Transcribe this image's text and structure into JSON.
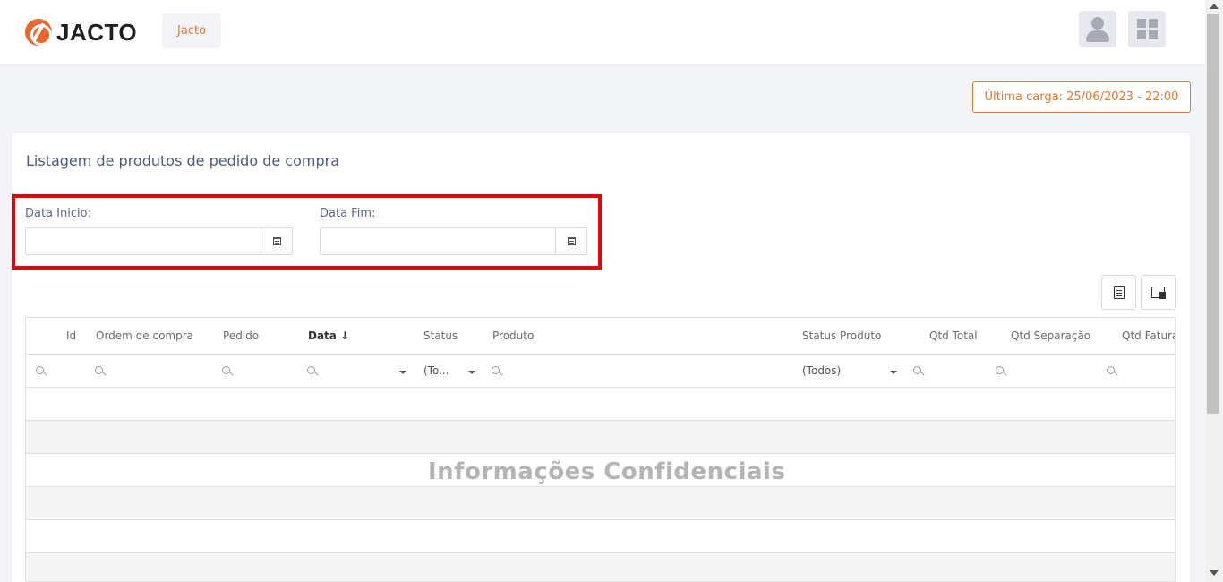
{
  "header": {
    "logo_text": "JACTO",
    "org_label": "Jacto",
    "user_icon": "user-icon",
    "apps_icon": "apps-grid-icon"
  },
  "last_load": "Última carga: 25/06/2023 - 22:00",
  "card": {
    "title": "Listagem de produtos de pedido de compra"
  },
  "filters": {
    "start_label": "Data Inicio:",
    "start_value": "",
    "end_label": "Data Fim:",
    "end_value": ""
  },
  "toolbar": {
    "export_icon": "export-excel-icon",
    "column_chooser_icon": "column-chooser-icon"
  },
  "grid": {
    "columns": [
      "Id",
      "Ordem de compra",
      "Pedido",
      "Data ↓",
      "Status",
      "Produto",
      "Status Produto",
      "Qtd Total",
      "Qtd Separação",
      "Qtd Fatura"
    ],
    "status_filter": "(To...",
    "status_produto_filter": "(Todos)"
  },
  "watermark": "Informações Confidenciais",
  "colors": {
    "accent": "#e8762c",
    "highlight": "#e8000b",
    "title": "#4b5a7e"
  }
}
